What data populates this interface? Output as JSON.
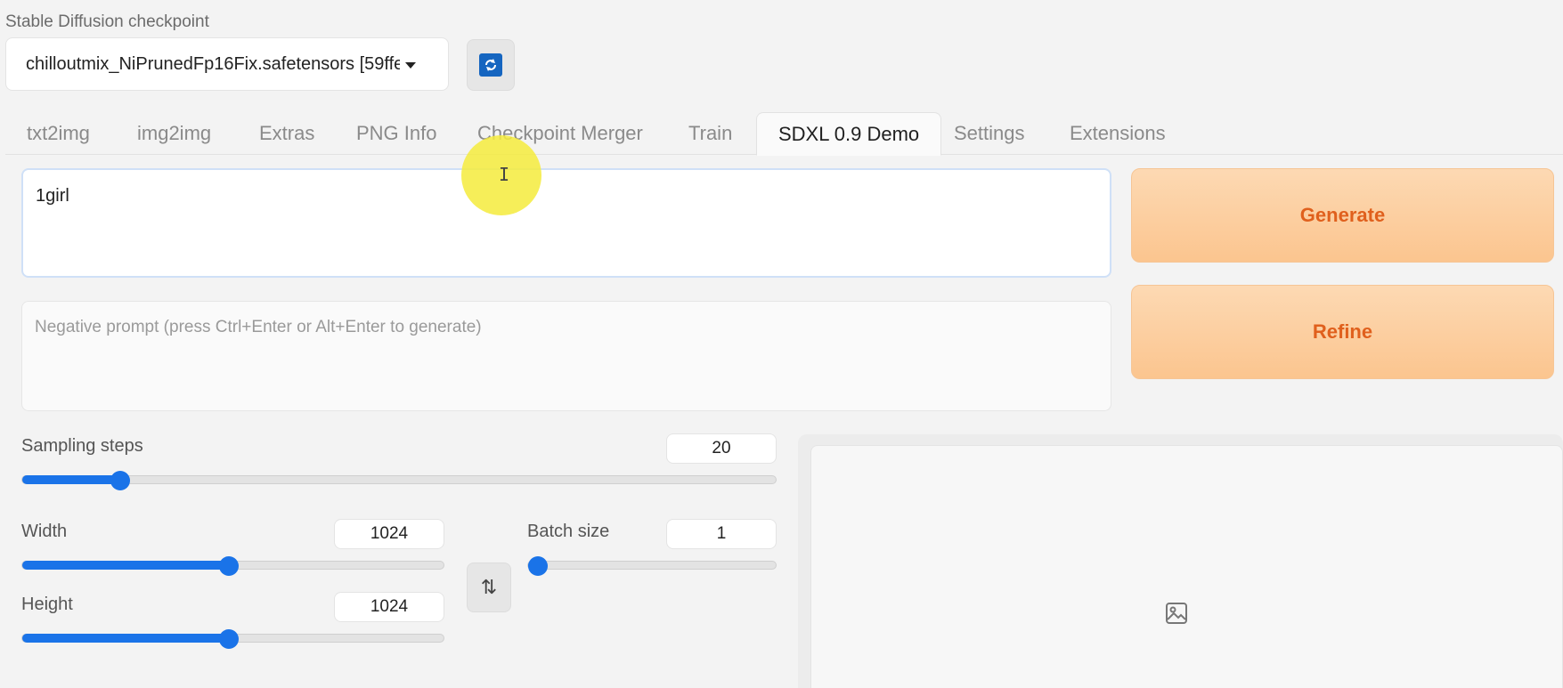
{
  "checkpoint": {
    "label": "Stable Diffusion checkpoint",
    "selected": "chilloutmix_NiPrunedFp16Fix.safetensors [59ffe",
    "refresh_icon": "refresh-icon"
  },
  "tabs": [
    {
      "label": "txt2img"
    },
    {
      "label": "img2img"
    },
    {
      "label": "Extras"
    },
    {
      "label": "PNG Info"
    },
    {
      "label": "Checkpoint Merger"
    },
    {
      "label": "Train"
    },
    {
      "label": "SDXL 0.9 Demo",
      "active": true
    },
    {
      "label": "Settings"
    },
    {
      "label": "Extensions"
    }
  ],
  "prompt": {
    "value": "1girl",
    "negative_placeholder": "Negative prompt (press Ctrl+Enter or Alt+Enter to generate)"
  },
  "buttons": {
    "generate": "Generate",
    "refine": "Refine"
  },
  "sliders": {
    "sampling_steps": {
      "label": "Sampling steps",
      "value": "20",
      "fraction": 0.13
    },
    "width": {
      "label": "Width",
      "value": "1024",
      "fraction": 0.49
    },
    "height": {
      "label": "Height",
      "value": "1024",
      "fraction": 0.49
    },
    "batch_size": {
      "label": "Batch size",
      "value": "1",
      "fraction": 0.0
    }
  },
  "swap_icon": "swap-icon",
  "gallery": {
    "icon": "image-icon"
  },
  "colors": {
    "accent": "#1a73e8",
    "generate_text": "#e0601d",
    "cursor_highlight": "#f5eb3c"
  }
}
